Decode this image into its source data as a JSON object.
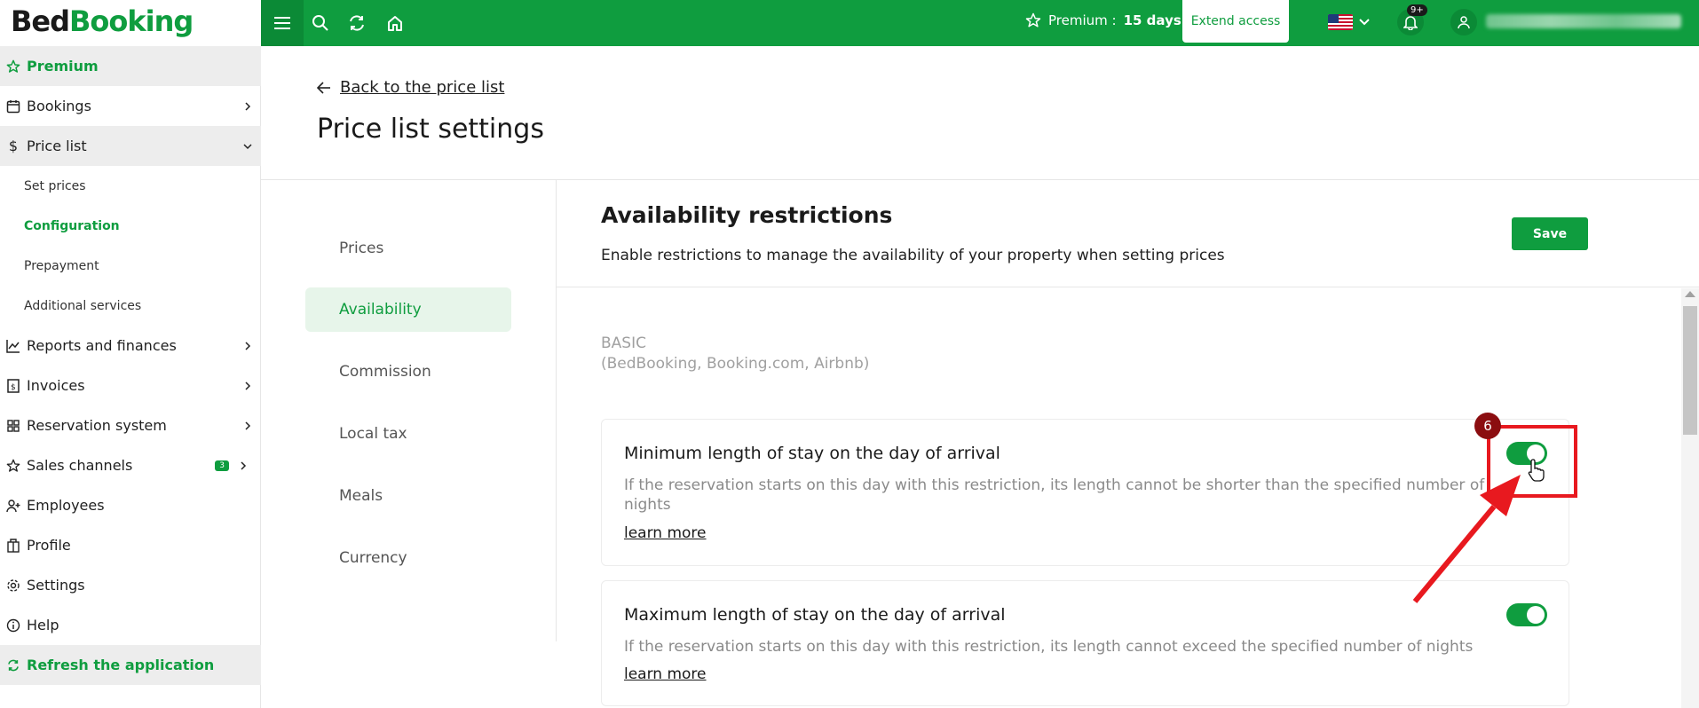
{
  "app": {
    "logo_part1": "Bed",
    "logo_part2": "Booking"
  },
  "topbar": {
    "premium_label": "Premium :",
    "premium_days": "15 days",
    "extend_label": "Extend access",
    "notif_count": "9+",
    "language": "en-US"
  },
  "sidebar": {
    "premium": "Premium",
    "bookings": "Bookings",
    "price_list": "Price list",
    "sub": [
      "Set prices",
      "Configuration",
      "Prepayment",
      "Additional services"
    ],
    "reports": "Reports and finances",
    "invoices": "Invoices",
    "reservation": "Reservation system",
    "sales": "Sales channels",
    "sales_badge": "3",
    "employees": "Employees",
    "profile": "Profile",
    "settings": "Settings",
    "help": "Help",
    "refresh": "Refresh the application"
  },
  "header": {
    "back": "Back to the price list",
    "title": "Price list settings"
  },
  "settings_nav": [
    "Prices",
    "Availability",
    "Commission",
    "Local tax",
    "Meals",
    "Currency"
  ],
  "section": {
    "title": "Availability restrictions",
    "desc": "Enable restrictions to manage the availability of your property when setting prices",
    "save": "Save",
    "group_line1": "BASIC",
    "group_line2": "(BedBooking, Booking.com, Airbnb)"
  },
  "cards": [
    {
      "title": "Minimum length of stay on the day of arrival",
      "desc_line1": "If the reservation starts on this day with this restriction, its length cannot be shorter than the specified number of",
      "desc_line2": "nights",
      "link": "learn more",
      "enabled": true
    },
    {
      "title": "Maximum length of stay on the day of arrival",
      "desc_line1": "If the reservation starts on this day with this restriction, its length cannot exceed the specified number of nights",
      "link": "learn more",
      "enabled": true
    }
  ],
  "annotation": {
    "step": "6",
    "color": "#e8191f"
  }
}
